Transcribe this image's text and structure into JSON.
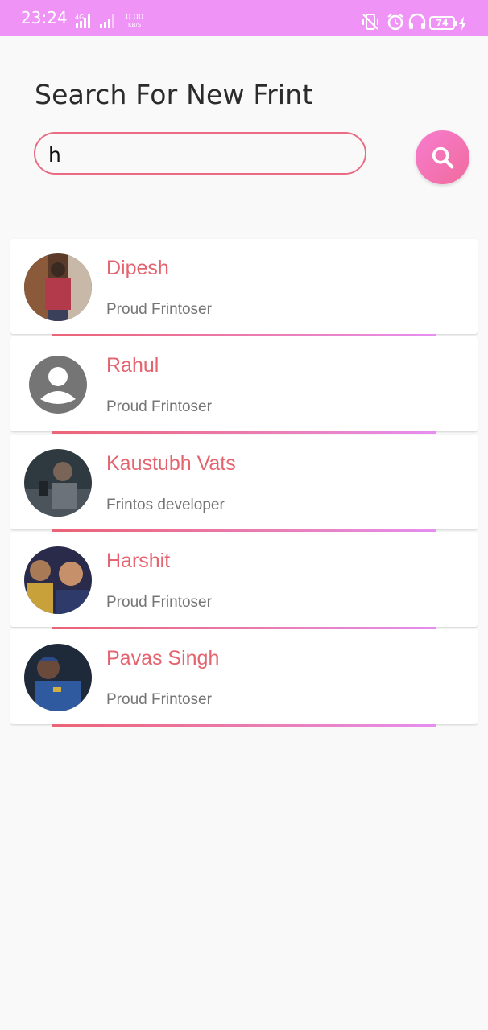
{
  "status_bar": {
    "time": "23:24",
    "network": "4G",
    "speed_value": "0.00",
    "speed_unit": "KB/S",
    "battery": "74",
    "icons": [
      "mute-vibrate-icon",
      "alarm-icon",
      "headphones-icon",
      "battery-icon",
      "charging-bolt-icon"
    ]
  },
  "header": {
    "title": "Search For New Frint"
  },
  "search": {
    "value": "h",
    "button_icon": "search-icon"
  },
  "results": [
    {
      "name": "Dipesh",
      "tagline": "Proud Frintoser",
      "avatar": "photo"
    },
    {
      "name": "Rahul",
      "tagline": "Proud Frintoser",
      "avatar": "default-person-icon"
    },
    {
      "name": "Kaustubh Vats",
      "tagline": "Frintos developer",
      "avatar": "photo"
    },
    {
      "name": "Harshit",
      "tagline": "Proud Frintoser",
      "avatar": "photo"
    },
    {
      "name": "Pavas Singh",
      "tagline": "Proud Frintoser",
      "avatar": "photo"
    }
  ],
  "colors": {
    "status_bar": "#ef93f6",
    "accent": "#e4636f",
    "search_button": "#f27ab8"
  }
}
